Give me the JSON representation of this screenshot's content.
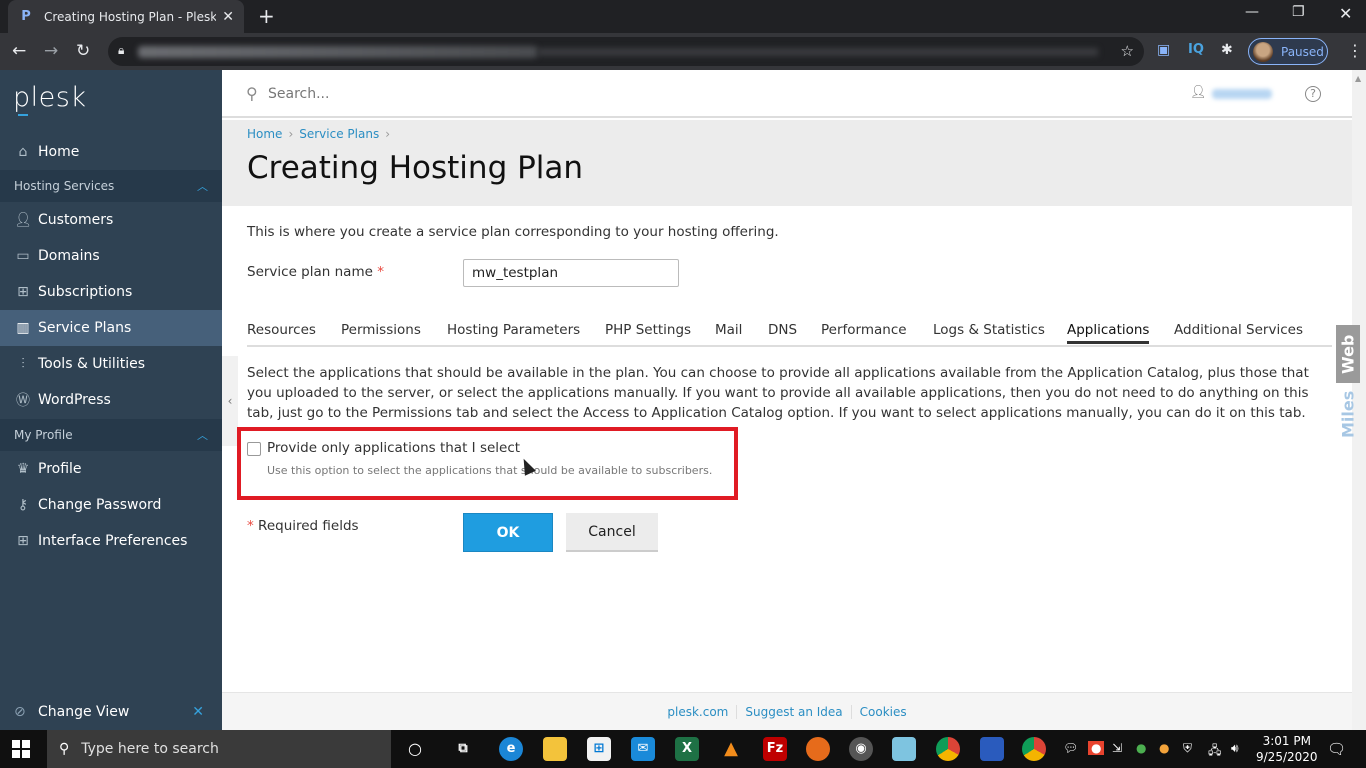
{
  "browser": {
    "tab_title": "Creating Hosting Plan - Plesk Ob",
    "favicon": "P",
    "profile_status": "Paused",
    "extensions": [
      "screen-recorder-icon",
      "iq-icon",
      "puzzle-icon"
    ]
  },
  "sidebar": {
    "logo": "plesk",
    "home": "Home",
    "groups": [
      {
        "label": "Hosting Services",
        "items": [
          {
            "label": "Customers",
            "icon": "user-icon"
          },
          {
            "label": "Domains",
            "icon": "monitor-icon"
          },
          {
            "label": "Subscriptions",
            "icon": "grid-icon"
          },
          {
            "label": "Service Plans",
            "icon": "book-icon",
            "active": true
          },
          {
            "label": "Tools & Utilities",
            "icon": "sliders-icon"
          },
          {
            "label": "WordPress",
            "icon": "wordpress-icon"
          }
        ]
      },
      {
        "label": "My Profile",
        "items": [
          {
            "label": "Profile",
            "icon": "crown-icon"
          },
          {
            "label": "Change Password",
            "icon": "key-icon"
          },
          {
            "label": "Interface Preferences",
            "icon": "layout-icon"
          }
        ]
      }
    ],
    "change_view": "Change View"
  },
  "header": {
    "search_placeholder": "Search..."
  },
  "breadcrumb": [
    "Home",
    "Service Plans"
  ],
  "page_title": "Creating Hosting Plan",
  "form": {
    "intro": "This is where you create a service plan corresponding to your hosting offering.",
    "plan_name_label": "Service plan name",
    "required_mark": "*",
    "plan_name_value": "mw_testplan",
    "tabs": [
      "Resources",
      "Permissions",
      "Hosting Parameters",
      "PHP Settings",
      "Mail",
      "DNS",
      "Performance",
      "Logs & Statistics",
      "Applications",
      "Additional Services"
    ],
    "active_tab": "Applications",
    "description": "Select the applications that should be available in the plan. You can choose to provide all applications available from the Application Catalog, plus those that you uploaded to the server, or select the applications manually. If you want to provide all available applications, then you do not need to do anything on this tab, just go to the Permissions tab and select the Access to Application Catalog option. If you want to select applications manually, you can do it on this tab.",
    "checkbox_label": "Provide only applications that I select",
    "checkbox_checked": false,
    "checkbox_hint": "Use this option to select the applications that should be available to subscribers.",
    "required_fields_note": "Required fields",
    "ok_label": "OK",
    "cancel_label": "Cancel"
  },
  "footer": {
    "links": [
      "plesk.com",
      "Suggest an Idea",
      "Cookies"
    ]
  },
  "watermark": {
    "part1": "Miles",
    "part2": "Web"
  },
  "taskbar": {
    "search_placeholder": "Type here to search",
    "time": "3:01 PM",
    "date": "9/25/2020"
  },
  "colors": {
    "sidebar_bg": "#2f4253",
    "accent": "#1f9de0",
    "highlight_border": "#e01b24"
  }
}
